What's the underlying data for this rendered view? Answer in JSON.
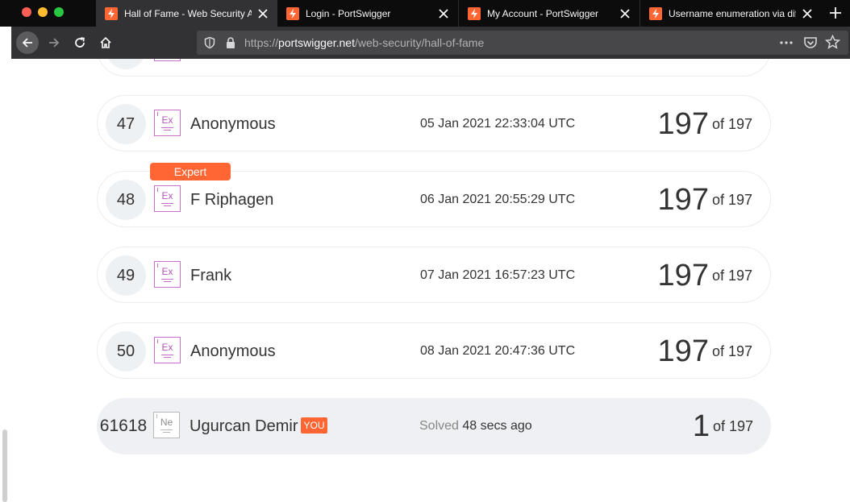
{
  "browser": {
    "tabs": [
      {
        "title": "Hall of Fame - Web Security Ac",
        "active": true
      },
      {
        "title": "Login - PortSwigger",
        "active": false
      },
      {
        "title": "My Account - PortSwigger",
        "active": false
      },
      {
        "title": "Username enumeration via diffe",
        "active": false
      }
    ],
    "url": {
      "scheme": "https://",
      "host": "portswigger.net",
      "path": "/web-security/hall-of-fame"
    },
    "colors": {
      "tab_favicon": "#ff6633",
      "traffic_close": "#ff5f57",
      "traffic_min": "#febc2e",
      "traffic_max": "#28c840"
    }
  },
  "leaderboard": {
    "rows": [
      {
        "rank": "47",
        "avatar": "Ex",
        "name": "Anonymous",
        "date": "05 Jan 2021 22:33:04 UTC",
        "score": "197",
        "of": "of 197"
      },
      {
        "rank": "48",
        "avatar": "Ex",
        "name": "F Riphagen",
        "date": "06 Jan 2021 20:55:29 UTC",
        "score": "197",
        "of": "of 197",
        "badge": "Expert"
      },
      {
        "rank": "49",
        "avatar": "Ex",
        "name": "Frank",
        "date": "07 Jan 2021 16:57:23 UTC",
        "score": "197",
        "of": "of 197"
      },
      {
        "rank": "50",
        "avatar": "Ex",
        "name": "Anonymous",
        "date": "08 Jan 2021 20:47:36 UTC",
        "score": "197",
        "of": "of 197"
      }
    ],
    "current_user": {
      "rank": "61618",
      "avatar": "Ne",
      "name": "Ugurcan Demir",
      "you_badge": "YOU",
      "solved_label": "Solved",
      "solved_time": "48 secs ago",
      "score": "1",
      "of": "of 197"
    },
    "colors": {
      "expert_avatar": "#c66fc8",
      "badge": "#ff6633",
      "current_row_bg": "#eef0f3"
    }
  }
}
